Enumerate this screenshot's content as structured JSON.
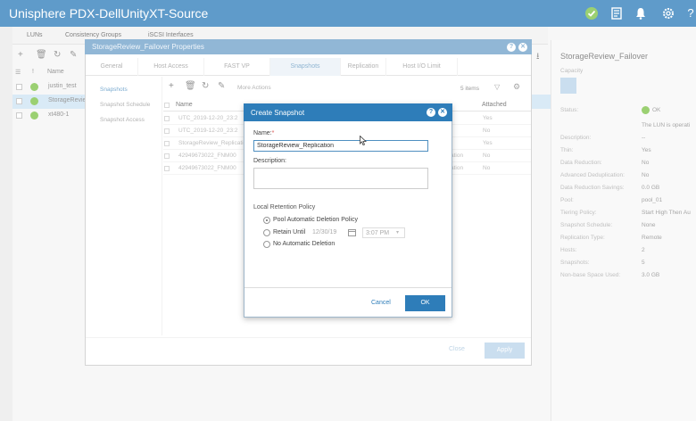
{
  "app": {
    "title": "Unisphere PDX-DellUnityXT-Source"
  },
  "background": {
    "tabs": [
      "LUNs",
      "Consistency Groups",
      "iSCSI Interfaces"
    ],
    "list_header": "Name",
    "list_col_index": "!",
    "rows": [
      {
        "name": "justin_test",
        "selected": false
      },
      {
        "name": "StorageRevie",
        "selected": true
      },
      {
        "name": "xt480-1",
        "selected": false
      }
    ]
  },
  "details": {
    "title": "StorageReview_Failover",
    "capacity_label": "Capacity",
    "fields": [
      {
        "label": "Status:",
        "value": "OK"
      },
      {
        "label": "",
        "value": "The LUN is operati"
      },
      {
        "label": "Description:",
        "value": "--"
      },
      {
        "label": "Thin:",
        "value": "Yes"
      },
      {
        "label": "Data Reduction:",
        "value": "No"
      },
      {
        "label": "Advanced Deduplication:",
        "value": "No"
      },
      {
        "label": "Data Reduction Savings:",
        "value": "0.0 GB"
      },
      {
        "label": "Pool:",
        "value": "pool_01"
      },
      {
        "label": "Tiering Policy:",
        "value": "Start High Then Au"
      },
      {
        "label": "Snapshot Schedule:",
        "value": "None"
      },
      {
        "label": "Replication Type:",
        "value": "Remote"
      },
      {
        "label": "Hosts:",
        "value": "2"
      },
      {
        "label": "Snapshots:",
        "value": "5"
      },
      {
        "label": "Non-base Space Used:",
        "value": "3.0 GB"
      }
    ]
  },
  "properties": {
    "title": "StorageReview_Failover Properties",
    "tabs": [
      "General",
      "Host Access",
      "FAST VP",
      "Snapshots",
      "Replication",
      "Host I/O Limit"
    ],
    "active_tab": "Snapshots",
    "side_items": [
      "Snapshots",
      "Snapshot Schedule",
      "Snapshot Access"
    ],
    "toolbar": {
      "more_actions": "More Actions",
      "item_count": "5 items"
    },
    "table": {
      "col_name": "Name",
      "col_attached": "Attached",
      "rows": [
        {
          "name": "UTC_2019-12-20_23:2",
          "source": "",
          "attached": "Yes"
        },
        {
          "name": "UTC_2019-12-20_23:2",
          "source": "",
          "attached": "No"
        },
        {
          "name": "StorageReview_Replication",
          "source": "",
          "attached": "Yes"
        },
        {
          "name": "42949673022_FNM00",
          "source": "ation",
          "attached": "No"
        },
        {
          "name": "42949673022_FNM00",
          "source": "ation",
          "attached": "No"
        }
      ]
    },
    "close_label": "Close",
    "apply_label": "Apply"
  },
  "create_snapshot": {
    "title": "Create Snapshot",
    "name_label": "Name:",
    "required_mark": "*",
    "name_value": "StorageReview_Replication",
    "description_label": "Description:",
    "description_value": "",
    "retention_label": "Local Retention Policy",
    "retention_options": [
      {
        "label": "Pool Automatic Deletion Policy",
        "selected": true
      },
      {
        "label": "Retain Until",
        "selected": false
      },
      {
        "label": "No Automatic Deletion",
        "selected": false
      }
    ],
    "retain_date": "12/30/19",
    "retain_time": "3:07 PM",
    "cancel_label": "Cancel",
    "ok_label": "OK"
  },
  "colors": {
    "header": "#2a7ab8",
    "accent": "#2e7db9",
    "status_ok": "#7ac143"
  }
}
